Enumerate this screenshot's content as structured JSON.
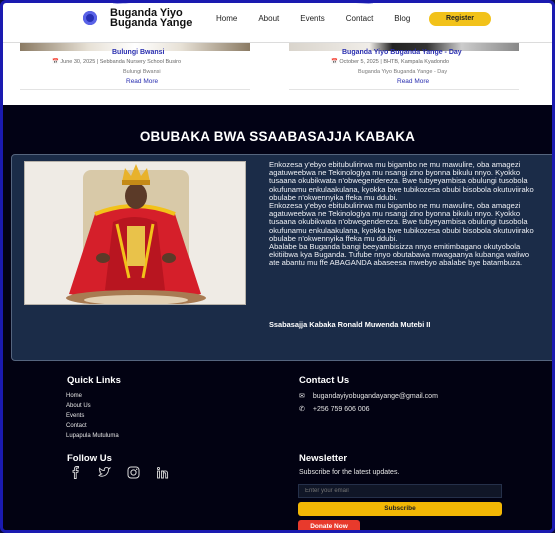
{
  "header": {
    "brand_line1": "Buganda Yiyo",
    "brand_line2": "Buganda Yange",
    "nav": [
      "Home",
      "About",
      "Events",
      "Contact",
      "Blog"
    ],
    "register_label": "Register"
  },
  "events": [
    {
      "title": "Bulungi Bwansi",
      "meta": "June 30, 2025 | Sebbanda Nursery School Busiro",
      "desc": "Bulungi Bwansi",
      "read_more": "Read More"
    },
    {
      "title": "Buganda Yiyo Buganda Yange - Day",
      "meta": "October 5, 2025 | BHTB, Kampala Kyadondo",
      "desc": "Buganda Yiyo Buganda Yange - Day",
      "read_more": "Read More"
    }
  ],
  "quote": {
    "section_title": "OBUBAKA BWA SSAABASAJJA KABAKA",
    "paragraphs": [
      "Enkozesa y'ebyo ebitubulirirwa mu bigambo ne mu mawulire, oba amagezi agatuweebwa ne Tekinologiya mu nsangi zino byonna bikulu nnyo. Kyokko tusaana okubikwata n'obwegendereza. Bwe tubyeyambisa obulungi tusobola okufunamu enkulaakulana, kyokka bwe tubikozesa obubi bisobola okutuviirako obulabe n'okwennyika ffeka mu ddubi.",
      "Enkozesa y'ebyo ebitubulirirwa mu bigambo ne mu mawulire, oba amagezi agatuweebwa ne Tekinologiya mu nsangi zino byonna bikulu nnyo. Kyokko tusaana okubikwata n'obwegendereza. Bwe tubyeyambisa obulungi tusobola okufunamu enkulaakulana, kyokka bwe tubikozesa obubi bisobola okutuviirako obulabe n'okwennyika ffeka mu ddubi.",
      "Abalabe ba Buganda bangi beeyambisizza nnyo emitimbagano okutyobola ekitiibwa kya Buganda. Tufube nnyo obutabawa mwagaanya kubanga waliwo ate abantu mu ffe ABAGANDA abaseesa mwebyo abalabe bye batambuza."
    ],
    "signature": "Ssabasajja Kabaka Ronald Muwenda Mutebi II"
  },
  "footer": {
    "quick_links_title": "Quick Links",
    "quick_links": [
      "Home",
      "About Us",
      "Events",
      "Contact",
      "Lupapula Mutuluma"
    ],
    "contact_title": "Contact Us",
    "email": "bugandayiyobugandayange@gmail.com",
    "phone": "+256 759 606 006",
    "follow_title": "Follow Us",
    "socials": [
      "facebook-icon",
      "twitter-icon",
      "instagram-icon",
      "linkedin-icon"
    ],
    "newsletter_title": "Newsletter",
    "newsletter_sub": "Subscribe for the latest updates.",
    "email_placeholder": "Enter your email",
    "subscribe_label": "Subscribe",
    "donate_label": "Donate Now"
  },
  "colors": {
    "accent_blue": "#2a2fb0",
    "accent_yellow": "#f2b705",
    "donate_red": "#e83a2c",
    "dark_bg": "#020215",
    "quote_bg": "#1b2c48"
  }
}
